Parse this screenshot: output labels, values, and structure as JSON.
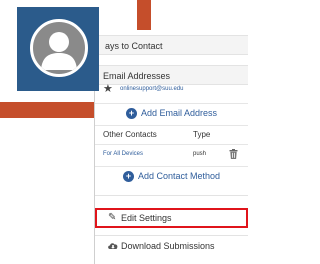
{
  "colors": {
    "accent": "#c54e2b",
    "link": "#2f5d9b",
    "highlight": "#e0141b",
    "avatar_bg": "#2b5b8b"
  },
  "menu": {
    "ways_to_contact": "ays to Contact",
    "email_section": "Email Addresses",
    "email": {
      "icon": "star-icon",
      "address": "onlinesupport@suu.edu"
    },
    "add_email": "Add Email Address",
    "contacts_header": {
      "label": "Other Contacts",
      "type": "Type"
    },
    "contact": {
      "label": "For All Devices",
      "type": "push"
    },
    "add_contact": "Add Contact Method",
    "edit_settings": "Edit Settings",
    "download_submissions": "Download Submissions"
  },
  "avatar": {
    "icon": "person-icon"
  }
}
